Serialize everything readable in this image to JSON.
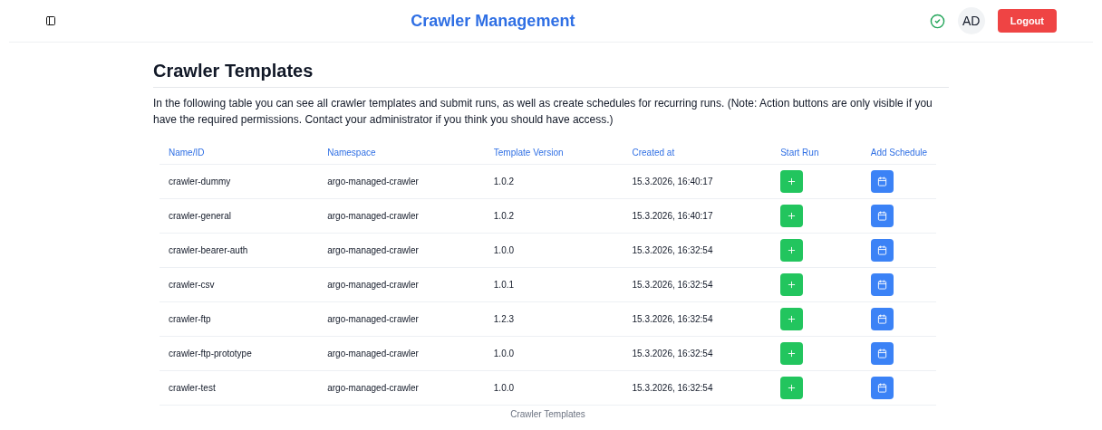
{
  "header": {
    "title": "Crawler Management",
    "avatar": "AD",
    "logout": "Logout"
  },
  "page": {
    "title": "Crawler Templates",
    "description": "In the following table you can see all crawler templates and submit runs, as well as create schedules for recurring runs. (Note: Action buttons are only visible if you have the required permissions. Contact your administrator if you think you should have access.)"
  },
  "table": {
    "columns": [
      "Name/ID",
      "Namespace",
      "Template Version",
      "Created at",
      "Start Run",
      "Add Schedule"
    ],
    "rows": [
      {
        "name": "crawler-dummy",
        "namespace": "argo-managed-crawler",
        "version": "1.0.2",
        "created": "15.3.2026, 16:40:17"
      },
      {
        "name": "crawler-general",
        "namespace": "argo-managed-crawler",
        "version": "1.0.2",
        "created": "15.3.2026, 16:40:17"
      },
      {
        "name": "crawler-bearer-auth",
        "namespace": "argo-managed-crawler",
        "version": "1.0.0",
        "created": "15.3.2026, 16:32:54"
      },
      {
        "name": "crawler-csv",
        "namespace": "argo-managed-crawler",
        "version": "1.0.1",
        "created": "15.3.2026, 16:32:54"
      },
      {
        "name": "crawler-ftp",
        "namespace": "argo-managed-crawler",
        "version": "1.2.3",
        "created": "15.3.2026, 16:32:54"
      },
      {
        "name": "crawler-ftp-prototype",
        "namespace": "argo-managed-crawler",
        "version": "1.0.0",
        "created": "15.3.2026, 16:32:54"
      },
      {
        "name": "crawler-test",
        "namespace": "argo-managed-crawler",
        "version": "1.0.0",
        "created": "15.3.2026, 16:32:54"
      }
    ],
    "caption": "Crawler Templates"
  }
}
